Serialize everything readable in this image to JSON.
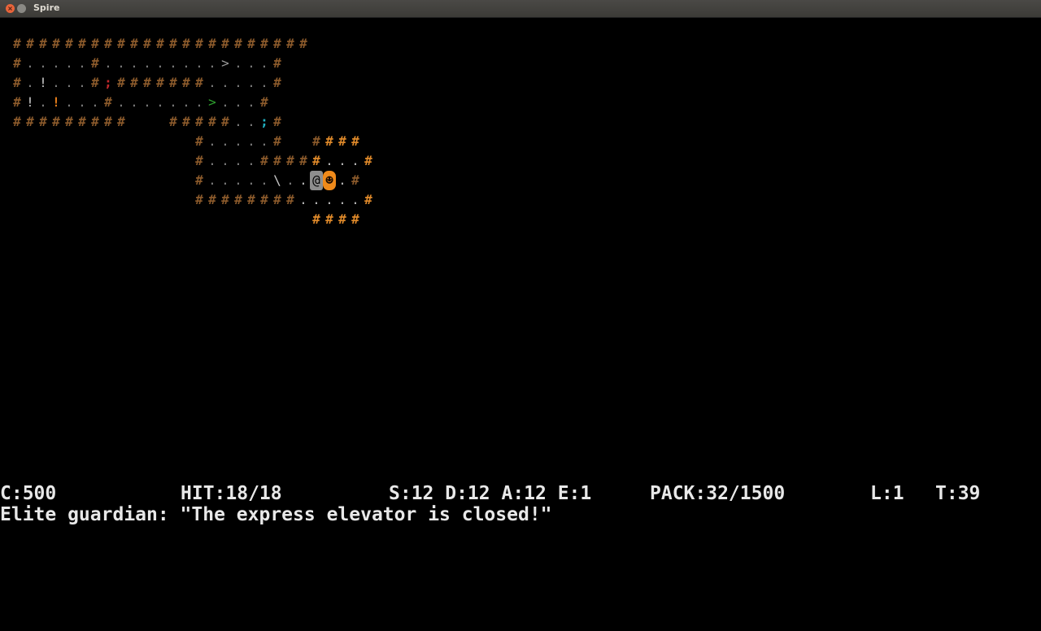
{
  "window": {
    "title": "Spire",
    "close_glyph": "×"
  },
  "map": {
    "rows": [
      "#######################      ",
      "#.....#.........>...#        ",
      "#.!...#;#######.....#        ",
      "#!.!...#.......>...#         ",
      "#########   #####..;#        ",
      "              #.....#  ####  ",
      "              #....#####...# ",
      "              #.....\\..@☻.#  ",
      "              ########.....# ",
      "                       ####  "
    ]
  },
  "status": {
    "credits": "C:500",
    "hit": "HIT:18/18",
    "stats": "S:12 D:12 A:12 E:1",
    "pack": "PACK:32/1500",
    "level": "L:1",
    "turn": "T:39"
  },
  "message": {
    "text": "Elite guardian: \"The express elevator is closed!\""
  },
  "colors": {
    "wall": "#8b5a2b",
    "lit_wall": "#e08a2a",
    "floor": "#7d7d7d",
    "stairs_down": "#9a9a9a",
    "stairs_green": "#2ea02e",
    "item_red": "#c0282c",
    "item_orange": "#e07a1a",
    "item_cyan": "#20b0c0",
    "player_bg": "#8e8e8e",
    "monster": "#f08a1a",
    "text": "#e8e8e8"
  },
  "icons": {
    "player": "player-at-icon",
    "monster": "elite-guardian-icon"
  }
}
